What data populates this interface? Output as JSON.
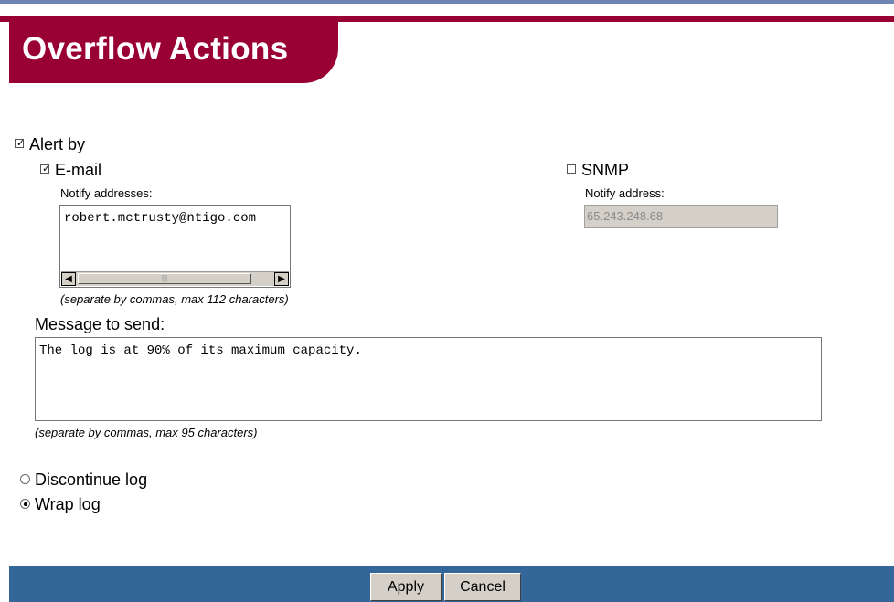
{
  "header": {
    "title": "Overflow Actions"
  },
  "alert_by": {
    "label": "Alert by",
    "checked": true,
    "email": {
      "label": "E-mail",
      "checked": true,
      "notify_label": "Notify addresses:",
      "value": "robert.mctrusty@ntigo.com",
      "hint": "(separate by commas, max 112 characters)"
    },
    "snmp": {
      "label": "SNMP",
      "checked": false,
      "notify_label": "Notify address:",
      "value": "65.243.248.68"
    }
  },
  "message": {
    "label": "Message to send:",
    "value": "The log is at 90% of its maximum capacity.",
    "hint": "(separate by commas, max 95 characters)"
  },
  "log_mode": {
    "options": [
      {
        "label": "Discontinue log",
        "selected": false
      },
      {
        "label": "Wrap log",
        "selected": true
      }
    ]
  },
  "footer": {
    "apply_label": "Apply",
    "cancel_label": "Cancel"
  },
  "colors": {
    "brand": "#990033",
    "footer": "#336699",
    "top_rule": "#6f86b5"
  },
  "icons": {
    "scroll_left": "arrow-left-icon",
    "scroll_right": "arrow-right-icon"
  }
}
